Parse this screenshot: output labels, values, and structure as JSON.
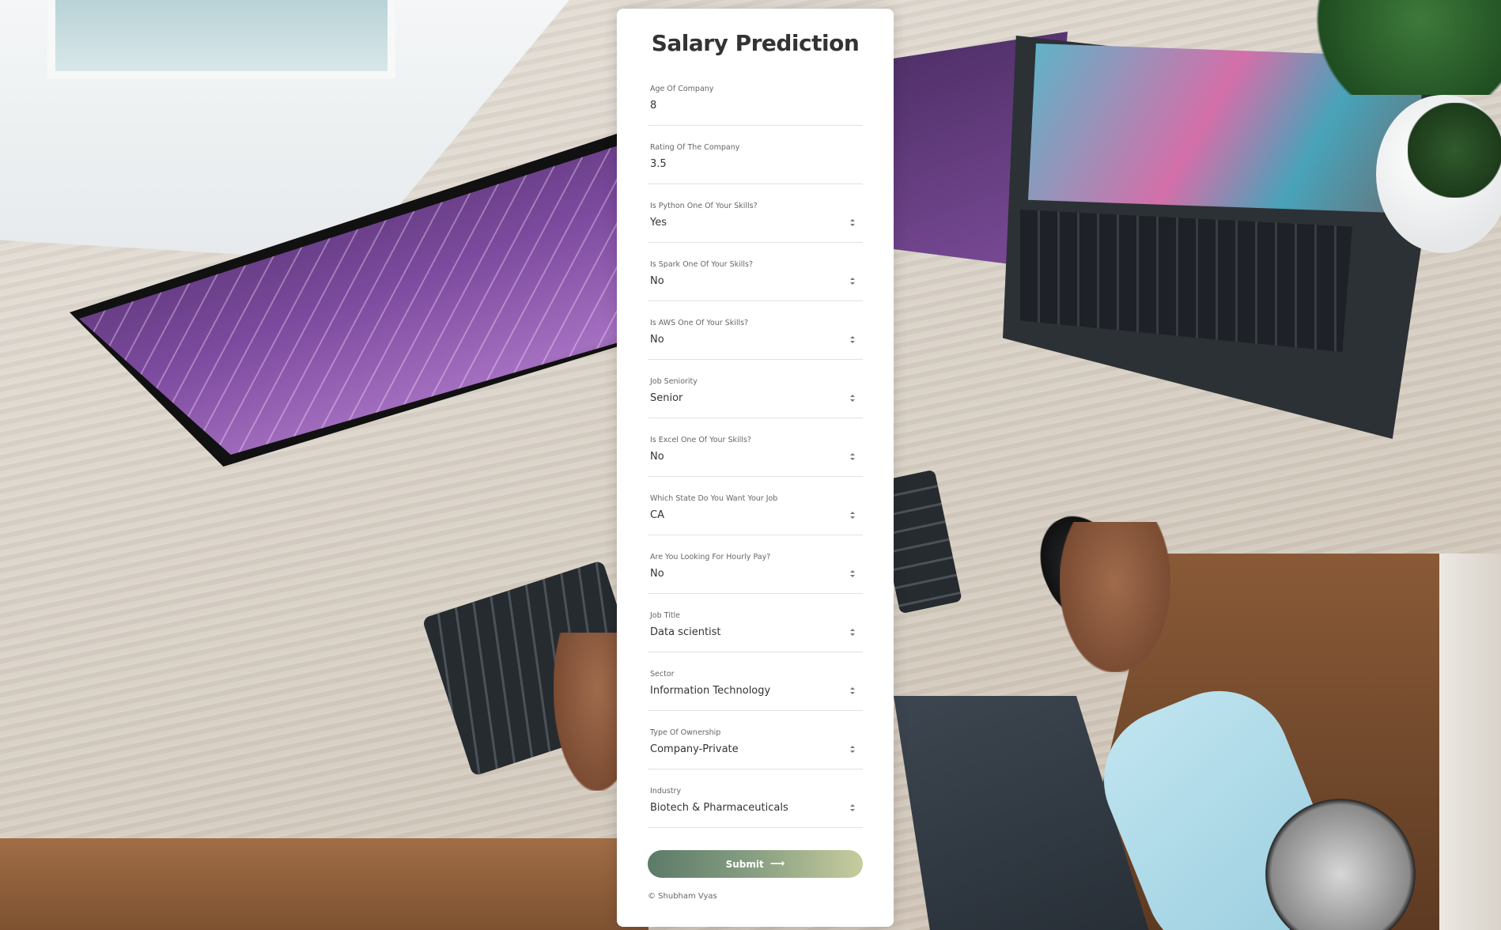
{
  "title": "Salary Prediction",
  "fields": [
    {
      "label": "Age Of Company",
      "value": "8",
      "type": "input"
    },
    {
      "label": "Rating Of The Company",
      "value": "3.5",
      "type": "input"
    },
    {
      "label": "Is Python One Of Your Skills?",
      "value": "Yes",
      "type": "select"
    },
    {
      "label": "Is Spark One Of Your Skills?",
      "value": "No",
      "type": "select"
    },
    {
      "label": "Is AWS One Of Your Skills?",
      "value": "No",
      "type": "select"
    },
    {
      "label": "Job Seniority",
      "value": "Senior",
      "type": "select"
    },
    {
      "label": "Is Excel One Of Your Skills?",
      "value": "No",
      "type": "select"
    },
    {
      "label": "Which State Do You Want Your Job",
      "value": "CA",
      "type": "select"
    },
    {
      "label": "Are You Looking For Hourly Pay?",
      "value": "No",
      "type": "select"
    },
    {
      "label": "Job Title",
      "value": "Data scientist",
      "type": "select"
    },
    {
      "label": "Sector",
      "value": "Information Technology",
      "type": "select"
    },
    {
      "label": "Type Of Ownership",
      "value": "Company-Private",
      "type": "select"
    },
    {
      "label": "Industry",
      "value": "Biotech & Pharmaceuticals",
      "type": "select"
    }
  ],
  "submit": {
    "label": "Submit",
    "icon": "arrow-right-icon"
  },
  "footer": "© Shubham Vyas",
  "colors": {
    "button_start": "#5c7a69",
    "button_end": "#c7cc9e",
    "title": "#333333"
  }
}
